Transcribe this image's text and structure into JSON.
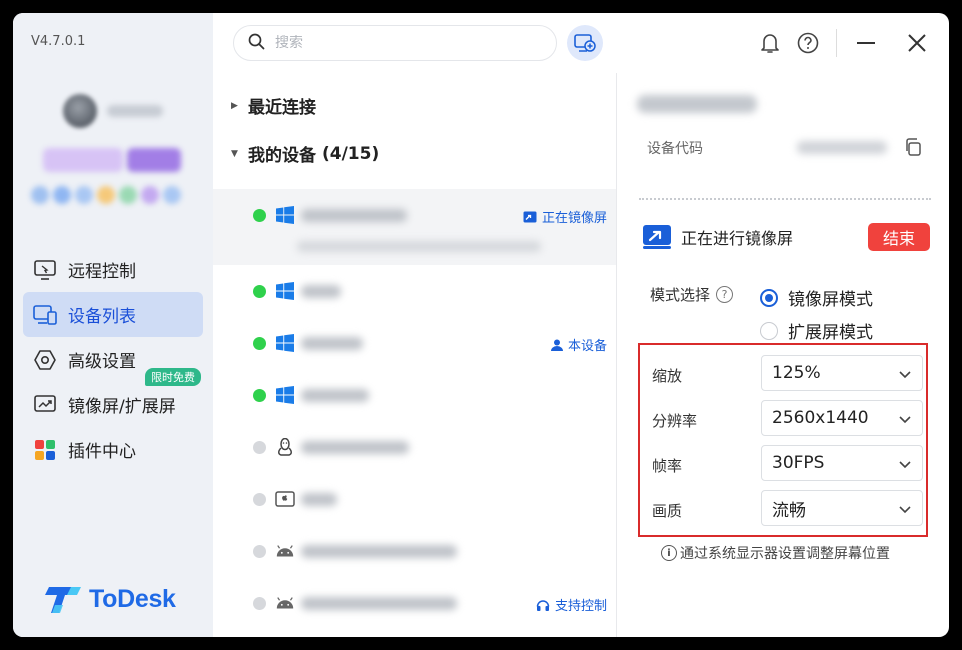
{
  "app": {
    "version": "V4.7.0.1",
    "brand": "ToDesk"
  },
  "sidebar": {
    "items": [
      {
        "label": "远程控制",
        "icon": "remote-control-icon",
        "active": false
      },
      {
        "label": "设备列表",
        "icon": "device-list-icon",
        "active": true
      },
      {
        "label": "高级设置",
        "icon": "advanced-settings-icon",
        "active": false
      },
      {
        "label": "镜像屏/扩展屏",
        "icon": "mirror-screen-icon",
        "active": false,
        "badge": "限时免费"
      },
      {
        "label": "插件中心",
        "icon": "plugin-center-icon",
        "active": false
      }
    ]
  },
  "search": {
    "placeholder": "搜索"
  },
  "device_list": {
    "recent_label": "最近连接",
    "my_devices_label": "我的设备",
    "my_devices_count": "(4/15)",
    "rows": [
      {
        "status": "online",
        "os": "windows",
        "tag": "正在镜像屏",
        "tag_icon": "mirror-screen-icon",
        "selected": true
      },
      {
        "status": "online",
        "os": "windows",
        "tag": ""
      },
      {
        "status": "online",
        "os": "windows",
        "tag": "本设备",
        "tag_icon": "user-icon"
      },
      {
        "status": "online",
        "os": "windows",
        "tag": ""
      },
      {
        "status": "offline",
        "os": "linux",
        "tag": ""
      },
      {
        "status": "offline",
        "os": "mac",
        "tag": ""
      },
      {
        "status": "offline",
        "os": "android",
        "tag": ""
      },
      {
        "status": "offline",
        "os": "android",
        "tag": "支持控制",
        "tag_icon": "remote-support-icon"
      }
    ]
  },
  "panel": {
    "device_code_label": "设备代码",
    "mirroring_status": "正在进行镜像屏",
    "end_button": "结束",
    "mode_label": "模式选择",
    "modes": [
      {
        "label": "镜像屏模式",
        "selected": true
      },
      {
        "label": "扩展屏模式",
        "selected": false
      }
    ],
    "settings": [
      {
        "label": "缩放",
        "value": "125%"
      },
      {
        "label": "分辨率",
        "value": "2560x1440"
      },
      {
        "label": "帧率",
        "value": "30FPS"
      },
      {
        "label": "画质",
        "value": "流畅"
      }
    ],
    "hint": "通过系统显示器设置调整屏幕位置"
  },
  "colors": {
    "accent": "#1a5fd8",
    "sidebar_active_bg": "#cfdcf5",
    "online": "#2fd14c",
    "end_button": "#f0423d",
    "highlight_box": "#d92b2b",
    "promo_badge": "#2eb88a"
  }
}
